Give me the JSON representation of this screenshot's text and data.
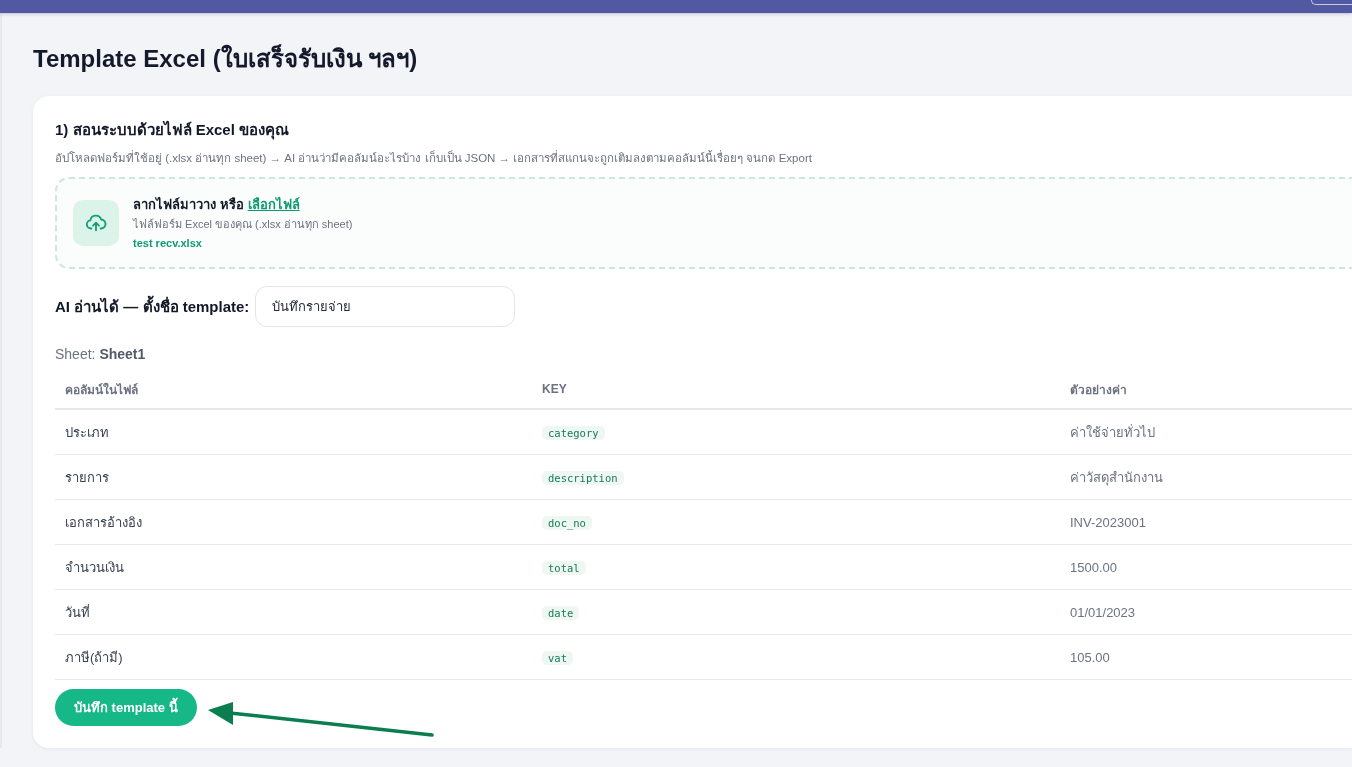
{
  "header_bar": {
    "partial_button": true
  },
  "page_title": "Template Excel (ใบเสร็จรับเงิน ฯลฯ)",
  "section": {
    "heading": "1) สอนระบบด้วยไฟล์ Excel ของคุณ",
    "description": "อัปโหลดฟอร์มที่ใช้อยู่ (.xlsx อ่านทุก sheet) → AI อ่านว่ามีคอลัมน์อะไรบ้าง เก็บเป็น JSON → เอกสารที่สแกนจะถูกเติมลงตามคอลัมน์นี้เรื่อยๆ จนกด Export"
  },
  "upload": {
    "prompt": "ลากไฟล์มาวาง หรือ",
    "link": "เลือกไฟล์",
    "hint": "ไฟล์ฟอร์ม Excel ของคุณ (.xlsx อ่านทุก sheet)",
    "file_name": "test recv.xlsx"
  },
  "template_name": {
    "label": "AI อ่านได้ — ตั้งชื่อ template:",
    "value": "บันทึกรายจ่าย"
  },
  "sheet": "Sheet: **Sheet1**",
  "table": {
    "columns": [
      "คอลัมน์ในไฟล์",
      "KEY",
      "ตัวอย่างค่า"
    ],
    "rows": [
      {
        "column": "ประเภท",
        "key": "category",
        "example": "ค่าใช้จ่ายทั่วไป"
      },
      {
        "column": "รายการ",
        "key": "description",
        "example": "ค่าวัสดุสำนักงาน"
      },
      {
        "column": "เอกสารอ้างอิง",
        "key": "doc_no",
        "example": "INV-2023001"
      },
      {
        "column": "จำนวนเงิน",
        "key": "total",
        "example": "1500.00"
      },
      {
        "column": "วันที่",
        "key": "date",
        "example": "01/01/2023"
      },
      {
        "column": "ภาษี(ถ้ามี)",
        "key": "vat",
        "example": "105.00"
      }
    ]
  },
  "save_button": "บันทึก template นี้",
  "annotation_arrow": true
}
